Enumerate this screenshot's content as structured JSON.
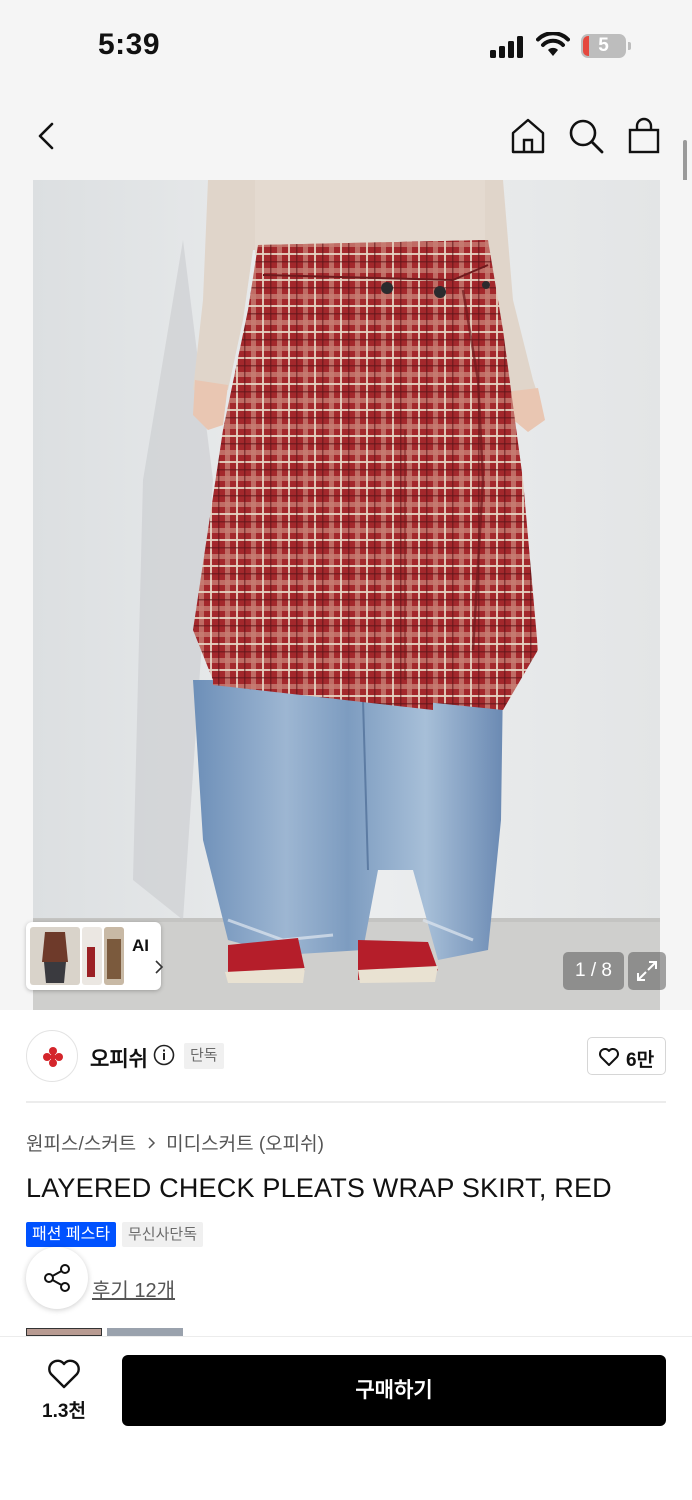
{
  "status_bar": {
    "time": "5:39",
    "battery": "5"
  },
  "nav": {
    "icons": [
      "back-icon",
      "home-icon",
      "search-icon",
      "cart-icon"
    ]
  },
  "gallery": {
    "counter": "1 / 8",
    "ai_label": "AI",
    "expand_icon": "expand-icon"
  },
  "brand": {
    "name": "오피쉬",
    "badge": "단독",
    "likes": "6만"
  },
  "product": {
    "breadcrumb": [
      "원피스/스커트",
      "미디스커트 (오피쉬)"
    ],
    "title": "LAYERED CHECK PLEATS WRAP SKIRT, RED",
    "tags": [
      "패션 페스타",
      "무신사단독"
    ],
    "review_link": "후기 12개"
  },
  "bottom": {
    "like_count": "1.3천",
    "buy_label": "구매하기"
  },
  "colors": {
    "accent": "#0052ff",
    "buy_button": "#000000",
    "skirt_red": "#a3282c",
    "denim": "#7d9cc0"
  }
}
